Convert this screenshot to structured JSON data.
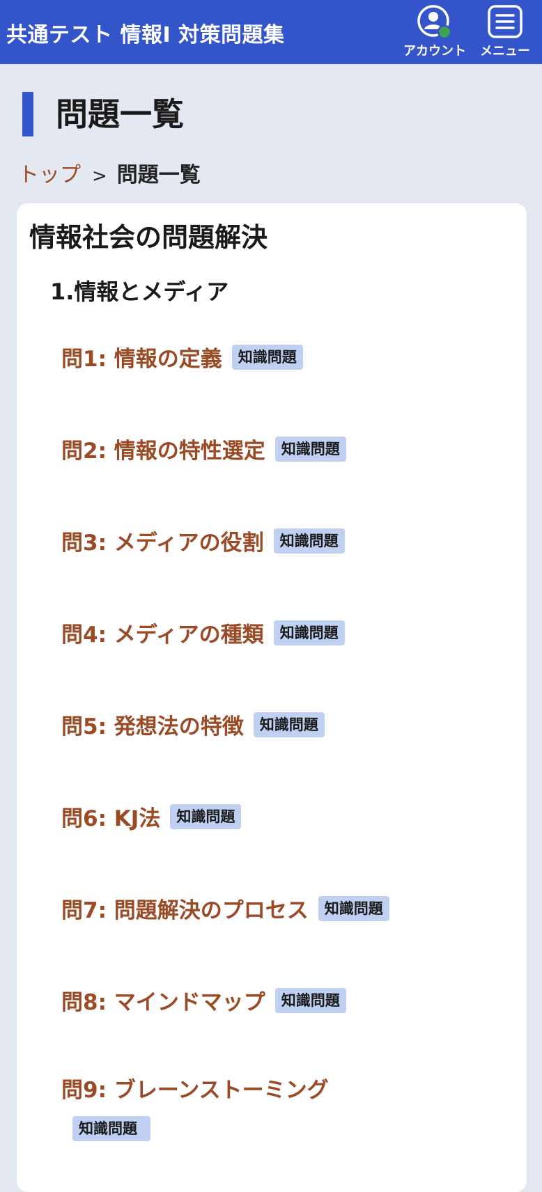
{
  "header": {
    "title": "共通テスト 情報I 対策問題集",
    "account_label": "アカウント",
    "menu_label": "メニュー",
    "account_icon": "account-icon",
    "menu_icon": "hamburger-menu-icon",
    "status_color": "#3fa34d"
  },
  "page": {
    "heading": "問題一覧",
    "accent_color": "#3355c9"
  },
  "breadcrumb": {
    "top": "トップ",
    "separator": ">",
    "current": "問題一覧"
  },
  "section": {
    "title": "情報社会の問題解決",
    "subsection": "1.情報とメディア"
  },
  "problems": [
    {
      "title": "問1: 情報の定義",
      "tag": "知識問題"
    },
    {
      "title": "問2: 情報の特性選定",
      "tag": "知識問題"
    },
    {
      "title": "問3: メディアの役割",
      "tag": "知識問題"
    },
    {
      "title": "問4: メディアの種類",
      "tag": "知識問題"
    },
    {
      "title": "問5: 発想法の特徴",
      "tag": "知識問題"
    },
    {
      "title": "問6: KJ法",
      "tag": "知識問題"
    },
    {
      "title": "問7: 問題解決のプロセス",
      "tag": "知識問題"
    },
    {
      "title": "問8: マインドマップ",
      "tag": "知識問題"
    },
    {
      "title": "問9: ブレーンストーミング",
      "tag": "知識問題"
    }
  ]
}
